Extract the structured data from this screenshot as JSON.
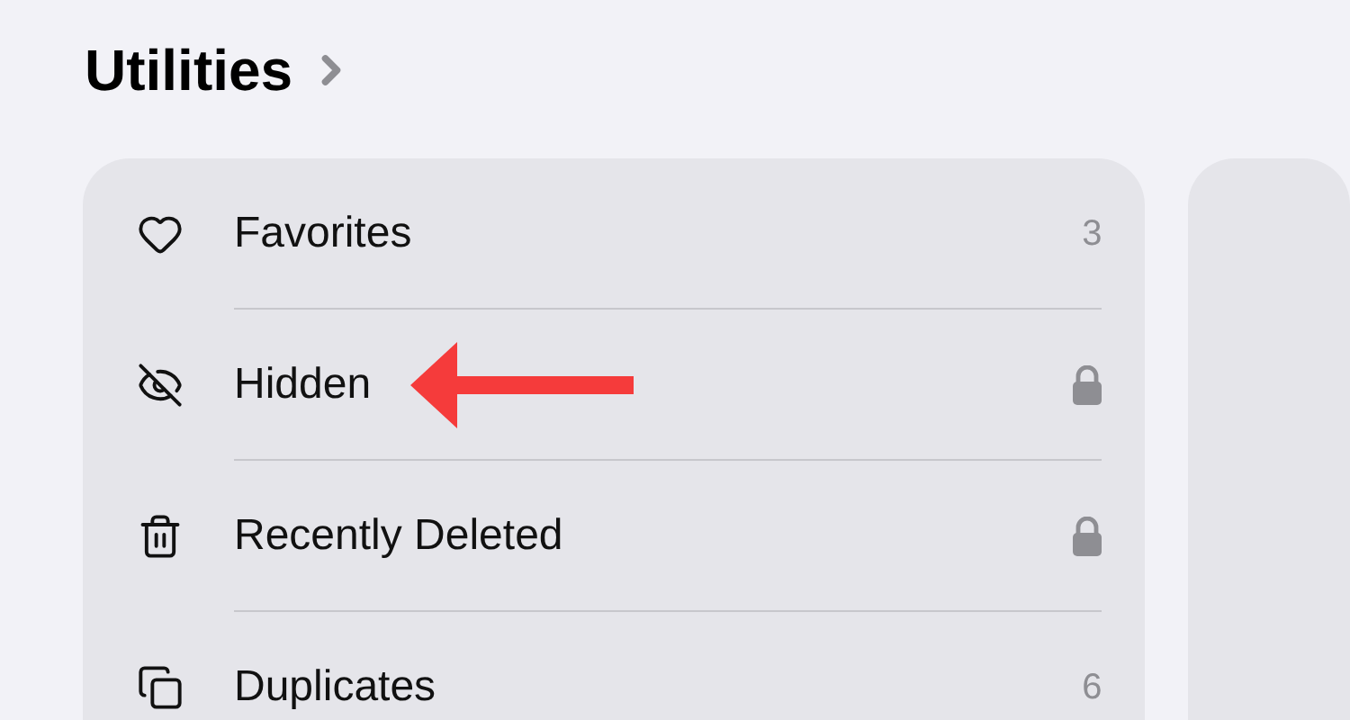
{
  "section": {
    "title": "Utilities"
  },
  "items": [
    {
      "label": "Favorites",
      "kind": "count",
      "count": "3"
    },
    {
      "label": "Hidden",
      "kind": "locked"
    },
    {
      "label": "Recently Deleted",
      "kind": "locked"
    },
    {
      "label": "Duplicates",
      "kind": "count",
      "count": "6"
    }
  ]
}
